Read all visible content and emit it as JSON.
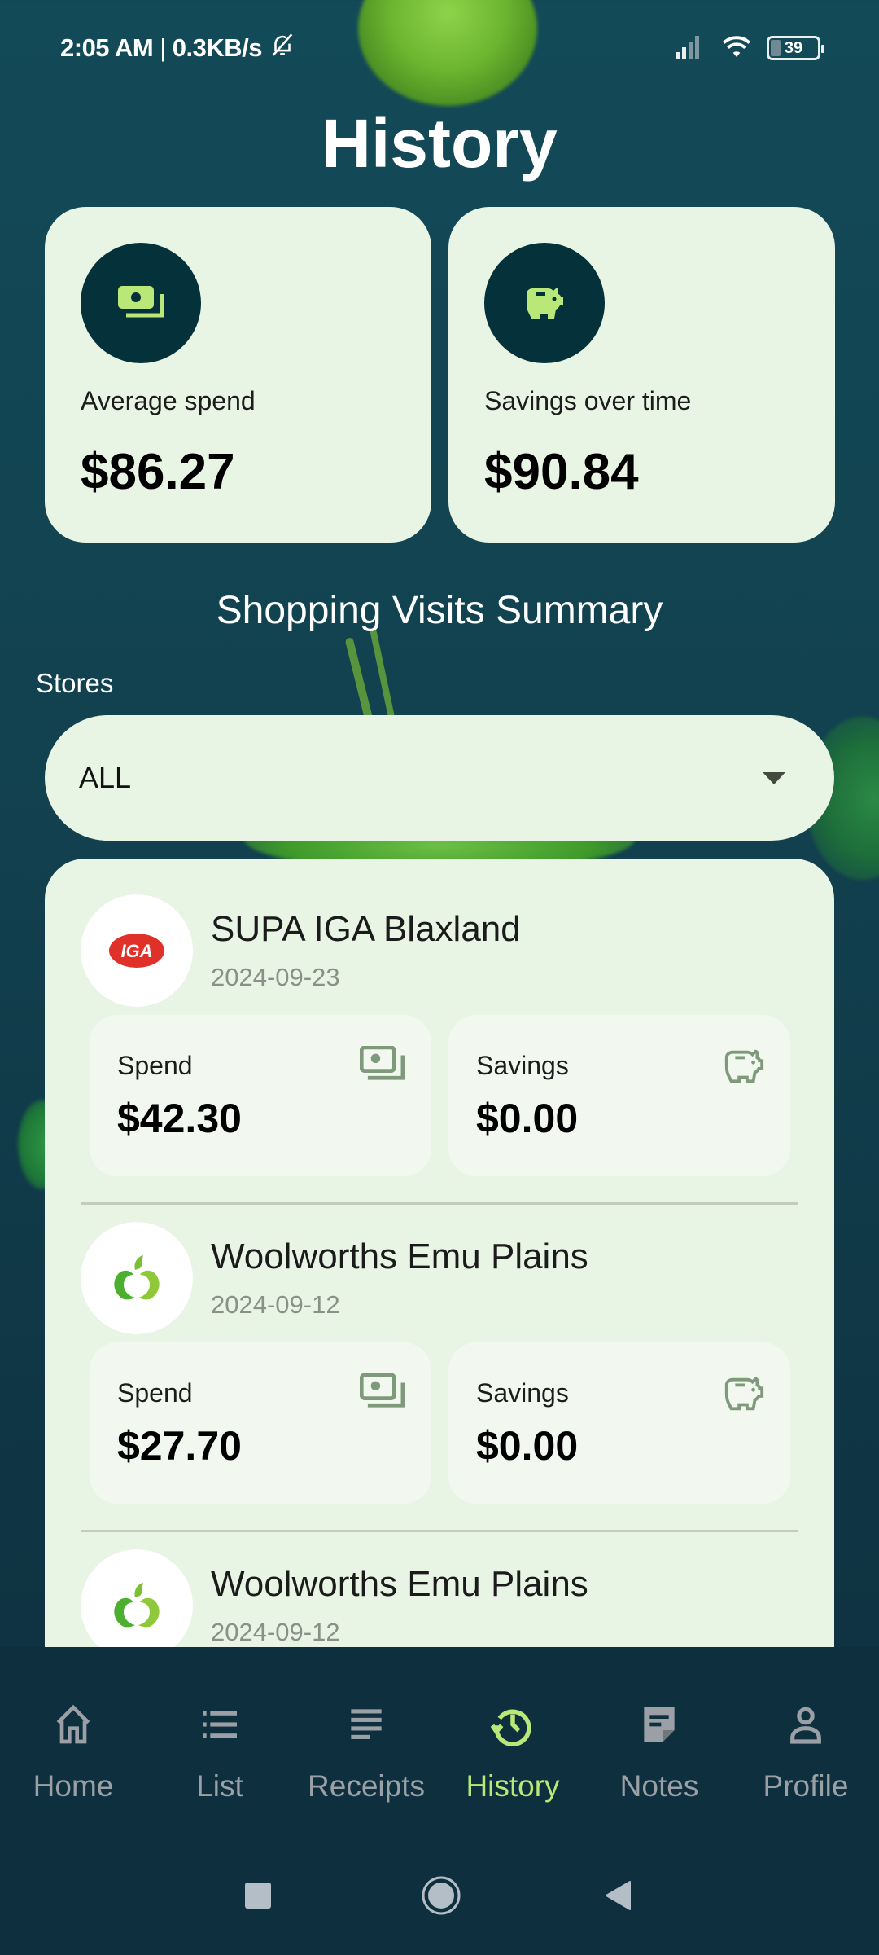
{
  "status_bar": {
    "time": "2:05 AM",
    "separator": "|",
    "network_speed": "0.3KB/s",
    "battery": "39",
    "icons": [
      "bell-off-icon",
      "signal-icon",
      "wifi-icon",
      "battery-icon"
    ]
  },
  "header": {
    "title": "History"
  },
  "summary": [
    {
      "label": "Average spend",
      "value": "$86.27",
      "icon": "cash-icon"
    },
    {
      "label": "Savings over time",
      "value": "$90.84",
      "icon": "piggy-bank-icon"
    }
  ],
  "section_title": "Shopping Visits Summary",
  "filter": {
    "label": "Stores",
    "selected": "ALL"
  },
  "visits": [
    {
      "store": "SUPA IGA Blaxland",
      "date": "2024-09-23",
      "logo": "iga-logo",
      "spend_label": "Spend",
      "spend": "$42.30",
      "savings_label": "Savings",
      "savings": "$0.00"
    },
    {
      "store": "Woolworths Emu Plains",
      "date": "2024-09-12",
      "logo": "woolworths-logo",
      "spend_label": "Spend",
      "spend": "$27.70",
      "savings_label": "Savings",
      "savings": "$0.00"
    },
    {
      "store": "Woolworths Emu Plains",
      "date": "2024-09-12",
      "logo": "woolworths-logo"
    }
  ],
  "bottom_nav": [
    {
      "label": "Home",
      "icon": "home-icon",
      "active": false
    },
    {
      "label": "List",
      "icon": "list-icon",
      "active": false
    },
    {
      "label": "Receipts",
      "icon": "receipts-icon",
      "active": false
    },
    {
      "label": "History",
      "icon": "history-icon",
      "active": true
    },
    {
      "label": "Notes",
      "icon": "notes-icon",
      "active": false
    },
    {
      "label": "Profile",
      "icon": "profile-icon",
      "active": false
    }
  ],
  "colors": {
    "accent": "#b9e778",
    "icon_circle": "#05313a",
    "card_bg": "#e8f4e4",
    "nav_bg": "#0e2f3d",
    "inactive_nav": "#9aa0a6"
  }
}
